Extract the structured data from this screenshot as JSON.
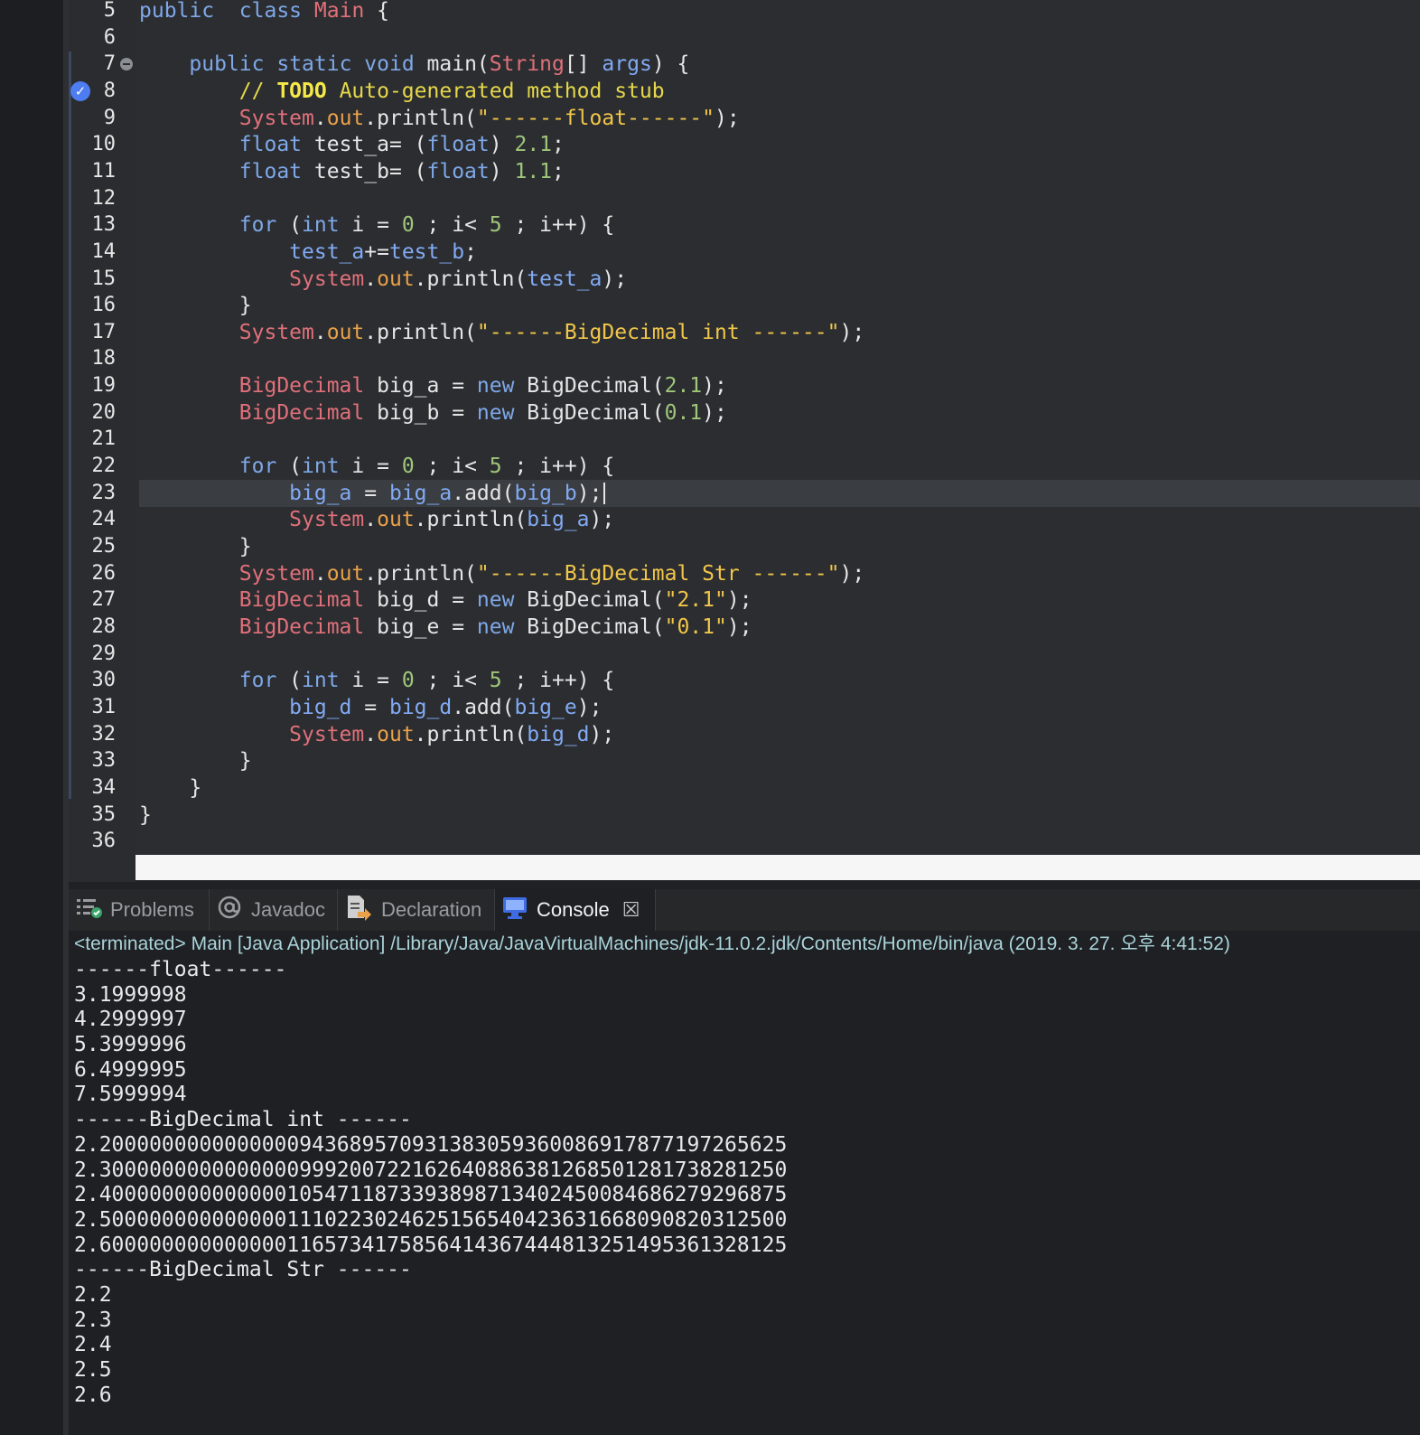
{
  "editor": {
    "lines": [
      {
        "n": "5",
        "tokens": [
          [
            "kw",
            "public"
          ],
          [
            "",
            "  "
          ],
          [
            "kw",
            "class"
          ],
          [
            "",
            " "
          ],
          [
            "ty",
            "Main"
          ],
          [
            "",
            " {"
          ]
        ]
      },
      {
        "n": "6",
        "tokens": []
      },
      {
        "n": "7",
        "fold": true,
        "tokens": [
          [
            "",
            "    "
          ],
          [
            "kw",
            "public"
          ],
          [
            "",
            " "
          ],
          [
            "kw",
            "static"
          ],
          [
            "",
            " "
          ],
          [
            "kw",
            "void"
          ],
          [
            "",
            " main("
          ],
          [
            "ty",
            "String"
          ],
          [
            "",
            "[] "
          ],
          [
            "var",
            "args"
          ],
          [
            "",
            ") {"
          ]
        ]
      },
      {
        "n": "8",
        "task": true,
        "tokens": [
          [
            "",
            "        "
          ],
          [
            "cmt",
            "// "
          ],
          [
            "todo",
            "TODO"
          ],
          [
            "cmt",
            " Auto-generated method stub"
          ]
        ]
      },
      {
        "n": "9",
        "tokens": [
          [
            "",
            "        "
          ],
          [
            "ty",
            "System"
          ],
          [
            "",
            "."
          ],
          [
            "fld",
            "out"
          ],
          [
            "",
            ".println("
          ],
          [
            "str",
            "\"------float------\""
          ],
          [
            "",
            ");"
          ]
        ]
      },
      {
        "n": "10",
        "tokens": [
          [
            "",
            "        "
          ],
          [
            "kw",
            "float"
          ],
          [
            "",
            " test_a= ("
          ],
          [
            "kw",
            "float"
          ],
          [
            "",
            ") "
          ],
          [
            "num",
            "2.1"
          ],
          [
            "",
            ";"
          ]
        ]
      },
      {
        "n": "11",
        "tokens": [
          [
            "",
            "        "
          ],
          [
            "kw",
            "float"
          ],
          [
            "",
            " test_b= ("
          ],
          [
            "kw",
            "float"
          ],
          [
            "",
            ") "
          ],
          [
            "num",
            "1.1"
          ],
          [
            "",
            ";"
          ]
        ]
      },
      {
        "n": "12",
        "tokens": []
      },
      {
        "n": "13",
        "tokens": [
          [
            "",
            "        "
          ],
          [
            "kw",
            "for"
          ],
          [
            "",
            " ("
          ],
          [
            "kw",
            "int"
          ],
          [
            "",
            " i = "
          ],
          [
            "num",
            "0"
          ],
          [
            "",
            " ; i< "
          ],
          [
            "num",
            "5"
          ],
          [
            "",
            " ; i++) {"
          ]
        ]
      },
      {
        "n": "14",
        "tokens": [
          [
            "",
            "            "
          ],
          [
            "var",
            "test_a"
          ],
          [
            "",
            "+="
          ],
          [
            "var",
            "test_b"
          ],
          [
            "",
            ";"
          ]
        ]
      },
      {
        "n": "15",
        "tokens": [
          [
            "",
            "            "
          ],
          [
            "ty",
            "System"
          ],
          [
            "",
            "."
          ],
          [
            "fld",
            "out"
          ],
          [
            "",
            ".println("
          ],
          [
            "var",
            "test_a"
          ],
          [
            "",
            ");"
          ]
        ]
      },
      {
        "n": "16",
        "tokens": [
          [
            "",
            "        }"
          ]
        ]
      },
      {
        "n": "17",
        "tokens": [
          [
            "",
            "        "
          ],
          [
            "ty",
            "System"
          ],
          [
            "",
            "."
          ],
          [
            "fld",
            "out"
          ],
          [
            "",
            ".println("
          ],
          [
            "str",
            "\"------BigDecimal int ------\""
          ],
          [
            "",
            ");"
          ]
        ]
      },
      {
        "n": "18",
        "tokens": []
      },
      {
        "n": "19",
        "tokens": [
          [
            "",
            "        "
          ],
          [
            "ty",
            "BigDecimal"
          ],
          [
            "",
            " big_a = "
          ],
          [
            "kw",
            "new"
          ],
          [
            "",
            " BigDecimal("
          ],
          [
            "num",
            "2.1"
          ],
          [
            "",
            ");"
          ]
        ]
      },
      {
        "n": "20",
        "tokens": [
          [
            "",
            "        "
          ],
          [
            "ty",
            "BigDecimal"
          ],
          [
            "",
            " big_b = "
          ],
          [
            "kw",
            "new"
          ],
          [
            "",
            " BigDecimal("
          ],
          [
            "num",
            "0.1"
          ],
          [
            "",
            ");"
          ]
        ]
      },
      {
        "n": "21",
        "tokens": []
      },
      {
        "n": "22",
        "tokens": [
          [
            "",
            "        "
          ],
          [
            "kw",
            "for"
          ],
          [
            "",
            " ("
          ],
          [
            "kw",
            "int"
          ],
          [
            "",
            " i = "
          ],
          [
            "num",
            "0"
          ],
          [
            "",
            " ; i< "
          ],
          [
            "num",
            "5"
          ],
          [
            "",
            " ; i++) {"
          ]
        ]
      },
      {
        "n": "23",
        "current": true,
        "tokens": [
          [
            "",
            "            "
          ],
          [
            "var",
            "big_a"
          ],
          [
            "",
            " = "
          ],
          [
            "var",
            "big_a"
          ],
          [
            "",
            ".add("
          ],
          [
            "var",
            "big_b"
          ],
          [
            "",
            ");"
          ]
        ]
      },
      {
        "n": "24",
        "tokens": [
          [
            "",
            "            "
          ],
          [
            "ty",
            "System"
          ],
          [
            "",
            "."
          ],
          [
            "fld",
            "out"
          ],
          [
            "",
            ".println("
          ],
          [
            "var",
            "big_a"
          ],
          [
            "",
            ");"
          ]
        ]
      },
      {
        "n": "25",
        "tokens": [
          [
            "",
            "        }"
          ]
        ]
      },
      {
        "n": "26",
        "tokens": [
          [
            "",
            "        "
          ],
          [
            "ty",
            "System"
          ],
          [
            "",
            "."
          ],
          [
            "fld",
            "out"
          ],
          [
            "",
            ".println("
          ],
          [
            "str",
            "\"------BigDecimal Str ------\""
          ],
          [
            "",
            ");"
          ]
        ]
      },
      {
        "n": "27",
        "tokens": [
          [
            "",
            "        "
          ],
          [
            "ty",
            "BigDecimal"
          ],
          [
            "",
            " big_d = "
          ],
          [
            "kw",
            "new"
          ],
          [
            "",
            " BigDecimal("
          ],
          [
            "str",
            "\"2.1\""
          ],
          [
            "",
            ");"
          ]
        ]
      },
      {
        "n": "28",
        "tokens": [
          [
            "",
            "        "
          ],
          [
            "ty",
            "BigDecimal"
          ],
          [
            "",
            " big_e = "
          ],
          [
            "kw",
            "new"
          ],
          [
            "",
            " BigDecimal("
          ],
          [
            "str",
            "\"0.1\""
          ],
          [
            "",
            ");"
          ]
        ]
      },
      {
        "n": "29",
        "tokens": []
      },
      {
        "n": "30",
        "tokens": [
          [
            "",
            "        "
          ],
          [
            "kw",
            "for"
          ],
          [
            "",
            " ("
          ],
          [
            "kw",
            "int"
          ],
          [
            "",
            " i = "
          ],
          [
            "num",
            "0"
          ],
          [
            "",
            " ; i< "
          ],
          [
            "num",
            "5"
          ],
          [
            "",
            " ; i++) {"
          ]
        ]
      },
      {
        "n": "31",
        "tokens": [
          [
            "",
            "            "
          ],
          [
            "var",
            "big_d"
          ],
          [
            "",
            " = "
          ],
          [
            "var",
            "big_d"
          ],
          [
            "",
            ".add("
          ],
          [
            "var",
            "big_e"
          ],
          [
            "",
            ");"
          ]
        ]
      },
      {
        "n": "32",
        "tokens": [
          [
            "",
            "            "
          ],
          [
            "ty",
            "System"
          ],
          [
            "",
            "."
          ],
          [
            "fld",
            "out"
          ],
          [
            "",
            ".println("
          ],
          [
            "var",
            "big_d"
          ],
          [
            "",
            ");"
          ]
        ]
      },
      {
        "n": "33",
        "tokens": [
          [
            "",
            "        }"
          ]
        ]
      },
      {
        "n": "34",
        "tokens": [
          [
            "",
            "    }"
          ]
        ]
      },
      {
        "n": "35",
        "tokens": [
          [
            "",
            "}"
          ]
        ]
      },
      {
        "n": "36",
        "tokens": []
      }
    ]
  },
  "console": {
    "tabs": [
      {
        "label": "Problems",
        "icon": "problems-icon"
      },
      {
        "label": "Javadoc",
        "icon": "at-icon"
      },
      {
        "label": "Declaration",
        "icon": "declaration-icon"
      },
      {
        "label": "Console",
        "icon": "console-icon",
        "active": true
      }
    ],
    "terminated": "<terminated> Main [Java Application] /Library/Java/JavaVirtualMachines/jdk-11.0.2.jdk/Contents/Home/bin/java (2019. 3. 27. 오후 4:41:52)",
    "output": [
      "------float------",
      "3.1999998",
      "4.2999997",
      "5.3999996",
      "6.4999995",
      "7.5999994",
      "------BigDecimal int ------",
      "2.2000000000000000943689570931383059360086917877197265625",
      "2.3000000000000000999200722162640886381268501281738281250",
      "2.4000000000000001054711873393898713402450084686279296875",
      "2.5000000000000001110223024625156540423631668090820312500",
      "2.6000000000000001165734175856414367444813251495361328125",
      "------BigDecimal Str ------",
      "2.2",
      "2.3",
      "2.4",
      "2.5",
      "2.6"
    ]
  }
}
